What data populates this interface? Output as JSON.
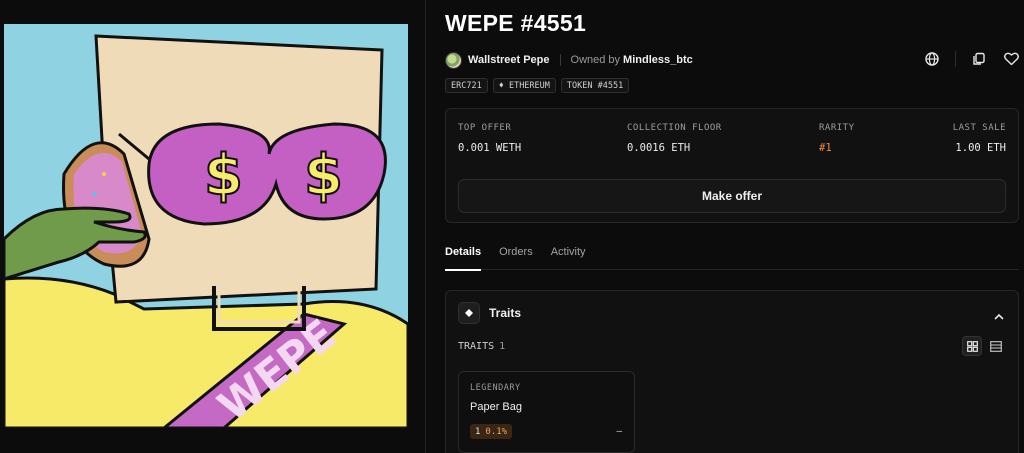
{
  "item": {
    "title": "WEPE #4551",
    "collection": "Wallstreet Pepe",
    "owned_by_label": "Owned by",
    "owner": "Mindless_btc"
  },
  "chips": [
    {
      "label": "ERC721"
    },
    {
      "label": "♦ ETHEREUM"
    },
    {
      "label": "TOKEN #4551"
    }
  ],
  "stats": [
    {
      "label": "TOP OFFER",
      "value": "0.001 WETH"
    },
    {
      "label": "COLLECTION FLOOR",
      "value": "0.0016 ETH"
    },
    {
      "label": "RARITY",
      "value": "#1"
    },
    {
      "label": "LAST SALE",
      "value": "1.00 ETH"
    }
  ],
  "make_offer_label": "Make offer",
  "tabs": [
    {
      "label": "Details"
    },
    {
      "label": "Orders"
    },
    {
      "label": "Activity"
    }
  ],
  "traits": {
    "title": "Traits",
    "count_label": "TRAITS",
    "count": "1",
    "items": [
      {
        "type": "LEGENDARY",
        "value": "Paper Bag",
        "count": "1",
        "percent": "0.1%",
        "price": "–"
      }
    ]
  },
  "colors": {
    "background": "#0c0c0c",
    "panel": "#111111",
    "accent_orange": "#f0883e"
  },
  "icons": [
    "globe-icon",
    "copy-icon",
    "heart-icon",
    "traits-diamond-icon",
    "chevron-up-icon",
    "grid-view-icon",
    "list-view-icon"
  ]
}
